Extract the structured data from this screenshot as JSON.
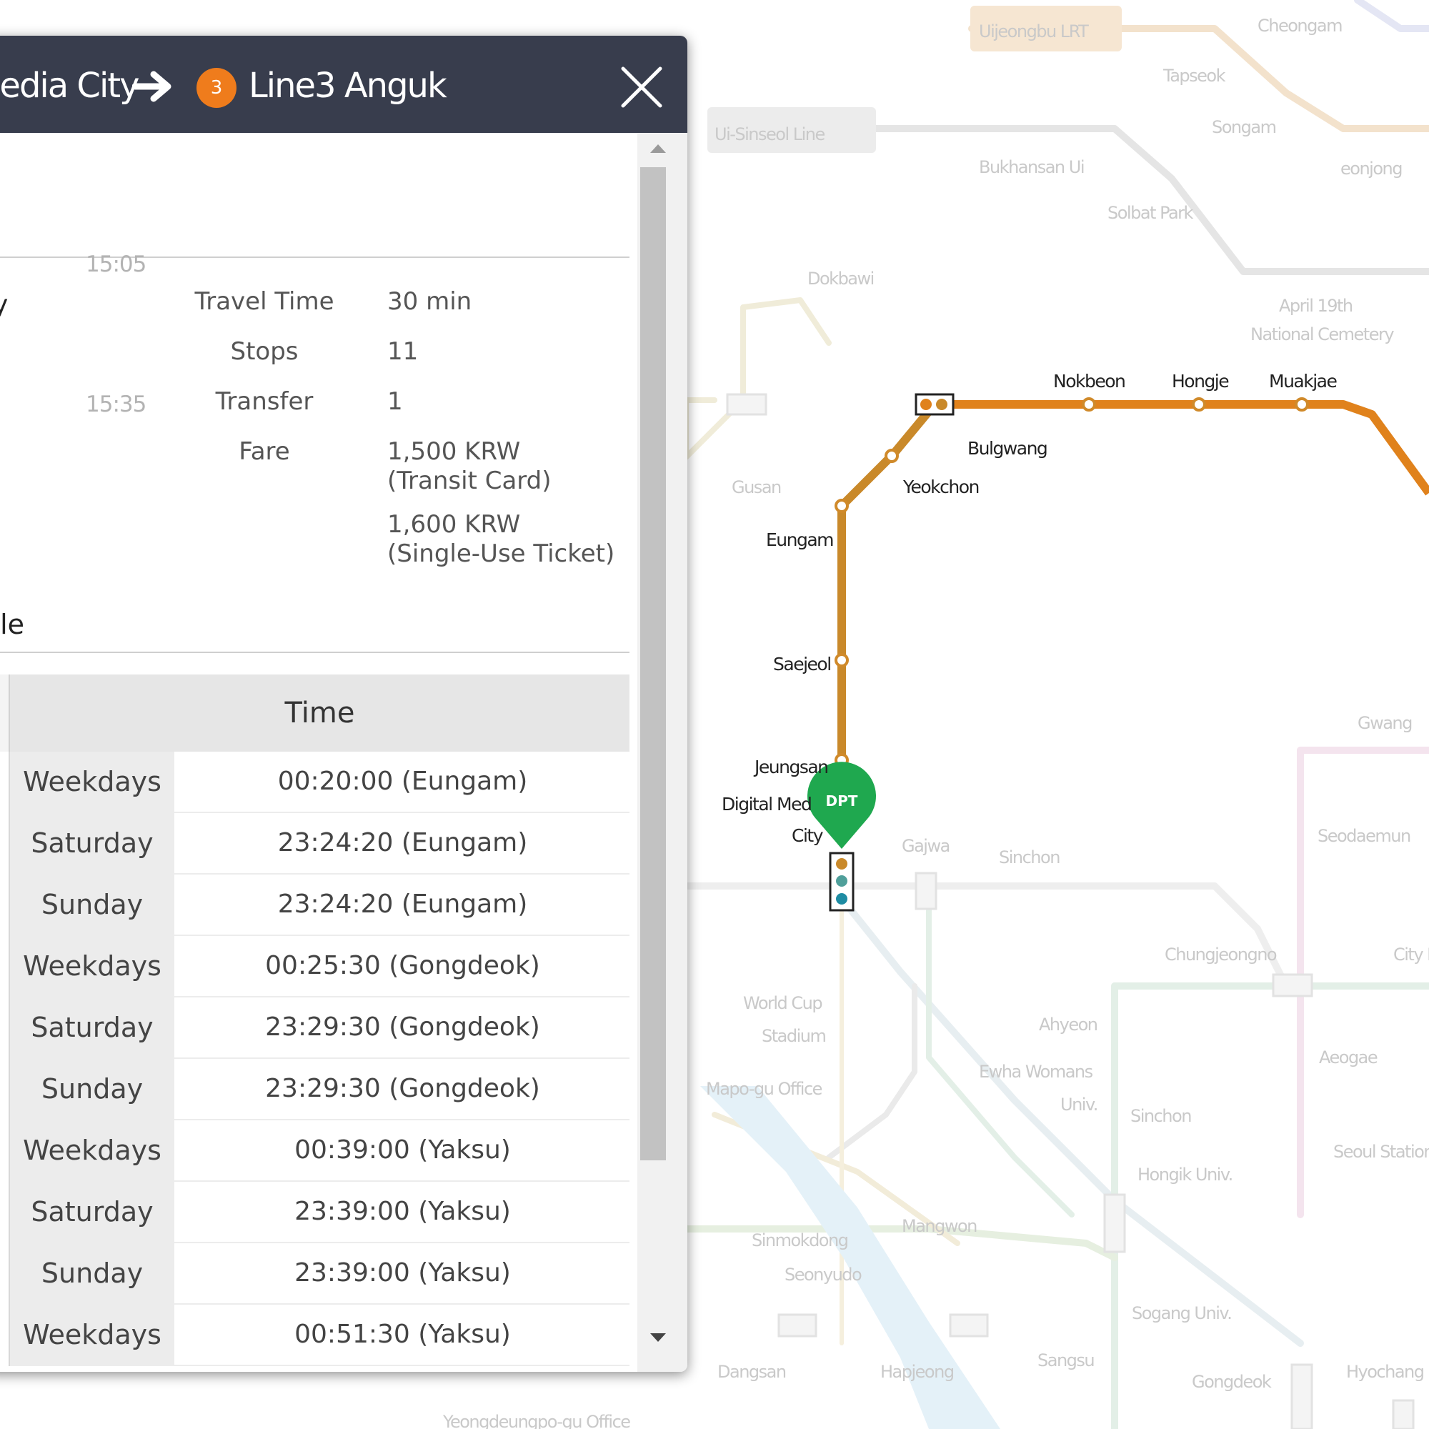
{
  "header": {
    "from_station": "Media City",
    "to_line_number": "3",
    "to_station": "Line3 Anguk"
  },
  "summary": {
    "departure_time": "15:05",
    "arrival_time": "15:35",
    "cut_text": "y",
    "travel_time_label": "Travel Time",
    "travel_time_value": "30 min",
    "stops_label": "Stops",
    "stops_value": "11",
    "transfer_label": "Transfer",
    "transfer_value": "1",
    "fare_label": "Fare",
    "fare_card_line1": "1,500 KRW",
    "fare_card_line2": "(Transit Card)",
    "fare_ticket_line1": "1,600 KRW",
    "fare_ticket_line2": "(Single-Use Ticket)"
  },
  "timetable": {
    "section_label": "ble",
    "header_time": "Time",
    "rows": [
      {
        "day": "Weekdays",
        "time": "00:20:00 (Eungam)"
      },
      {
        "day": "Saturday",
        "time": "23:24:20 (Eungam)"
      },
      {
        "day": "Sunday",
        "time": "23:24:20 (Eungam)"
      },
      {
        "day": "Weekdays",
        "time": "00:25:30 (Gongdeok)"
      },
      {
        "day": "Saturday",
        "time": "23:29:30 (Gongdeok)"
      },
      {
        "day": "Sunday",
        "time": "23:29:30 (Gongdeok)"
      },
      {
        "day": "Weekdays",
        "time": "00:39:00 (Yaksu)"
      },
      {
        "day": "Saturday",
        "time": "23:39:00 (Yaksu)"
      },
      {
        "day": "Sunday",
        "time": "23:39:00 (Yaksu)"
      },
      {
        "day": "Weekdays",
        "time": "00:51:30 (Yaksu)"
      }
    ]
  },
  "map": {
    "route_color": "#e0821c",
    "line6_color": "#c9892a",
    "marker_label": "DPT",
    "marker_color": "#1fa84f",
    "stations": {
      "nokbeon": "Nokbeon",
      "hongje": "Hongje",
      "muakjae": "Muakjae",
      "bulgwang": "Bulgwang",
      "yeokchon": "Yeokchon",
      "eungam": "Eungam",
      "saejeol": "Saejeol",
      "jeungsan": "Jeungsan",
      "dmc_line1": "Digital Med",
      "dmc_line2": "City"
    },
    "faint_labels": {
      "uijeongbu_badge": "Uijeongbu LRT",
      "wooisinseol_badge": "Ui-Sinseol Line",
      "cheongam": "Cheongam",
      "tapseok": "Tapseok",
      "songam": "Songam",
      "bukhansan": "Bukhansan Ui",
      "solbat": "Solbat Park",
      "ganeung": "eonjong",
      "dokbawi": "Dokbawi",
      "april19": "April 19th",
      "cemetery": "National Cemetery",
      "gusan": "Gusan",
      "gajwa": "Gajwa",
      "sinchon": "Sinchon",
      "seodaemun": "Seodaemun",
      "chungjeongno": "Chungjeongno",
      "cityhall": "City H",
      "worldcup1": "World Cup",
      "worldcup2": "Stadium",
      "mapogu": "Mapo-gu Office",
      "ahyeon": "Ahyeon",
      "ewha1": "Ewha Womans",
      "ewha2": "Univ.",
      "sinchon2": "Sinchon",
      "aeogae": "Aeogae",
      "hongik": "Hongik Univ.",
      "seoulstation": "Seoul Station",
      "mangwon": "Mangwon",
      "sangsu": "Sangsu",
      "hapjeong": "Hapjeong",
      "dangsan": "Dangsan",
      "sogang": "Sogang Univ.",
      "gongdeok": "Gongdeok",
      "hyochang": "Hyochang",
      "yeongdeungpo": "Yeongdeungpo-gu Office",
      "seonyudo": "Seonyudo",
      "sinmok": "Sinmokdong",
      "gwang": "Gwang"
    }
  }
}
